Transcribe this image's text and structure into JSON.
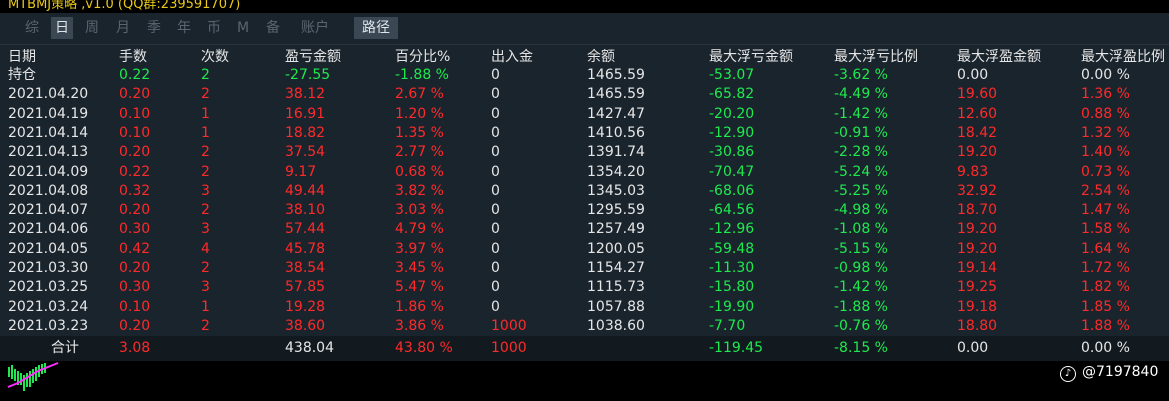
{
  "window_title": "MTBMJ策略 ,v1.0 (QQ群:239591707)",
  "tabs": [
    {
      "label": "综",
      "active": false
    },
    {
      "label": "日",
      "active": true
    },
    {
      "label": "周",
      "active": false
    },
    {
      "label": "月",
      "active": false
    },
    {
      "label": "季",
      "active": false
    },
    {
      "label": "年",
      "active": false
    },
    {
      "label": "币",
      "active": false
    },
    {
      "label": "M",
      "active": false
    },
    {
      "label": "备",
      "active": false
    },
    {
      "label": "账户",
      "active": false
    },
    {
      "label": "路径",
      "active": true
    }
  ],
  "columns": [
    "日期",
    "手数",
    "次数",
    "盈亏金额",
    "百分比%",
    "出入金",
    "余额",
    "最大浮亏金额",
    "最大浮亏比例",
    "最大浮盈金额",
    "最大浮盈比例"
  ],
  "rows": [
    {
      "date": "持仓",
      "lots": "0.22",
      "count": "2",
      "pnl": "-27.55",
      "pct": "-1.88 %",
      "inout": "0",
      "balance": "1465.59",
      "maxloss": "-53.07",
      "maxloss_pct": "-3.62 %",
      "maxprofit": "0.00",
      "maxprofit_pct": "0.00 %"
    },
    {
      "date": "2021.04.20",
      "lots": "0.20",
      "count": "2",
      "pnl": "38.12",
      "pct": "2.67 %",
      "inout": "0",
      "balance": "1465.59",
      "maxloss": "-65.82",
      "maxloss_pct": "-4.49 %",
      "maxprofit": "19.60",
      "maxprofit_pct": "1.36 %"
    },
    {
      "date": "2021.04.19",
      "lots": "0.10",
      "count": "1",
      "pnl": "16.91",
      "pct": "1.20 %",
      "inout": "0",
      "balance": "1427.47",
      "maxloss": "-20.20",
      "maxloss_pct": "-1.42 %",
      "maxprofit": "12.60",
      "maxprofit_pct": "0.88 %"
    },
    {
      "date": "2021.04.14",
      "lots": "0.10",
      "count": "1",
      "pnl": "18.82",
      "pct": "1.35 %",
      "inout": "0",
      "balance": "1410.56",
      "maxloss": "-12.90",
      "maxloss_pct": "-0.91 %",
      "maxprofit": "18.42",
      "maxprofit_pct": "1.32 %"
    },
    {
      "date": "2021.04.13",
      "lots": "0.20",
      "count": "2",
      "pnl": "37.54",
      "pct": "2.77 %",
      "inout": "0",
      "balance": "1391.74",
      "maxloss": "-30.86",
      "maxloss_pct": "-2.28 %",
      "maxprofit": "19.20",
      "maxprofit_pct": "1.40 %"
    },
    {
      "date": "2021.04.09",
      "lots": "0.22",
      "count": "2",
      "pnl": "9.17",
      "pct": "0.68 %",
      "inout": "0",
      "balance": "1354.20",
      "maxloss": "-70.47",
      "maxloss_pct": "-5.24 %",
      "maxprofit": "9.83",
      "maxprofit_pct": "0.73 %"
    },
    {
      "date": "2021.04.08",
      "lots": "0.32",
      "count": "3",
      "pnl": "49.44",
      "pct": "3.82 %",
      "inout": "0",
      "balance": "1345.03",
      "maxloss": "-68.06",
      "maxloss_pct": "-5.25 %",
      "maxprofit": "32.92",
      "maxprofit_pct": "2.54 %"
    },
    {
      "date": "2021.04.07",
      "lots": "0.20",
      "count": "2",
      "pnl": "38.10",
      "pct": "3.03 %",
      "inout": "0",
      "balance": "1295.59",
      "maxloss": "-64.56",
      "maxloss_pct": "-4.98 %",
      "maxprofit": "18.70",
      "maxprofit_pct": "1.47 %"
    },
    {
      "date": "2021.04.06",
      "lots": "0.30",
      "count": "3",
      "pnl": "57.44",
      "pct": "4.79 %",
      "inout": "0",
      "balance": "1257.49",
      "maxloss": "-12.96",
      "maxloss_pct": "-1.08 %",
      "maxprofit": "19.20",
      "maxprofit_pct": "1.58 %"
    },
    {
      "date": "2021.04.05",
      "lots": "0.42",
      "count": "4",
      "pnl": "45.78",
      "pct": "3.97 %",
      "inout": "0",
      "balance": "1200.05",
      "maxloss": "-59.48",
      "maxloss_pct": "-5.15 %",
      "maxprofit": "19.20",
      "maxprofit_pct": "1.64 %"
    },
    {
      "date": "2021.03.30",
      "lots": "0.20",
      "count": "2",
      "pnl": "38.54",
      "pct": "3.45 %",
      "inout": "0",
      "balance": "1154.27",
      "maxloss": "-11.30",
      "maxloss_pct": "-0.98 %",
      "maxprofit": "19.14",
      "maxprofit_pct": "1.72 %"
    },
    {
      "date": "2021.03.25",
      "lots": "0.30",
      "count": "3",
      "pnl": "57.85",
      "pct": "5.47 %",
      "inout": "0",
      "balance": "1115.73",
      "maxloss": "-15.80",
      "maxloss_pct": "-1.42 %",
      "maxprofit": "19.25",
      "maxprofit_pct": "1.82 %"
    },
    {
      "date": "2021.03.24",
      "lots": "0.10",
      "count": "1",
      "pnl": "19.28",
      "pct": "1.86 %",
      "inout": "0",
      "balance": "1057.88",
      "maxloss": "-19.90",
      "maxloss_pct": "-1.88 %",
      "maxprofit": "19.18",
      "maxprofit_pct": "1.85 %"
    },
    {
      "date": "2021.03.23",
      "lots": "0.20",
      "count": "2",
      "pnl": "38.60",
      "pct": "3.86 %",
      "inout": "1000",
      "balance": "1038.60",
      "maxloss": "-7.70",
      "maxloss_pct": "-0.76 %",
      "maxprofit": "18.80",
      "maxprofit_pct": "1.88 %"
    }
  ],
  "totals": {
    "label": "合计",
    "lots": "3.08",
    "pnl": "438.04",
    "pct": "43.80 %",
    "inout": "1000",
    "maxloss": "-119.45",
    "maxloss_pct": "-8.15 %",
    "maxprofit": "0.00",
    "maxprofit_pct": "0.00 %"
  },
  "watermark": "@7197840",
  "colors": {
    "profit": "#ff2a2a",
    "loss": "#1eea4e",
    "neutral": "#e6e6e6",
    "panel_bg": "#1a242d",
    "totals_bg": "#121a20",
    "tab_active_bg": "#3b4753"
  }
}
